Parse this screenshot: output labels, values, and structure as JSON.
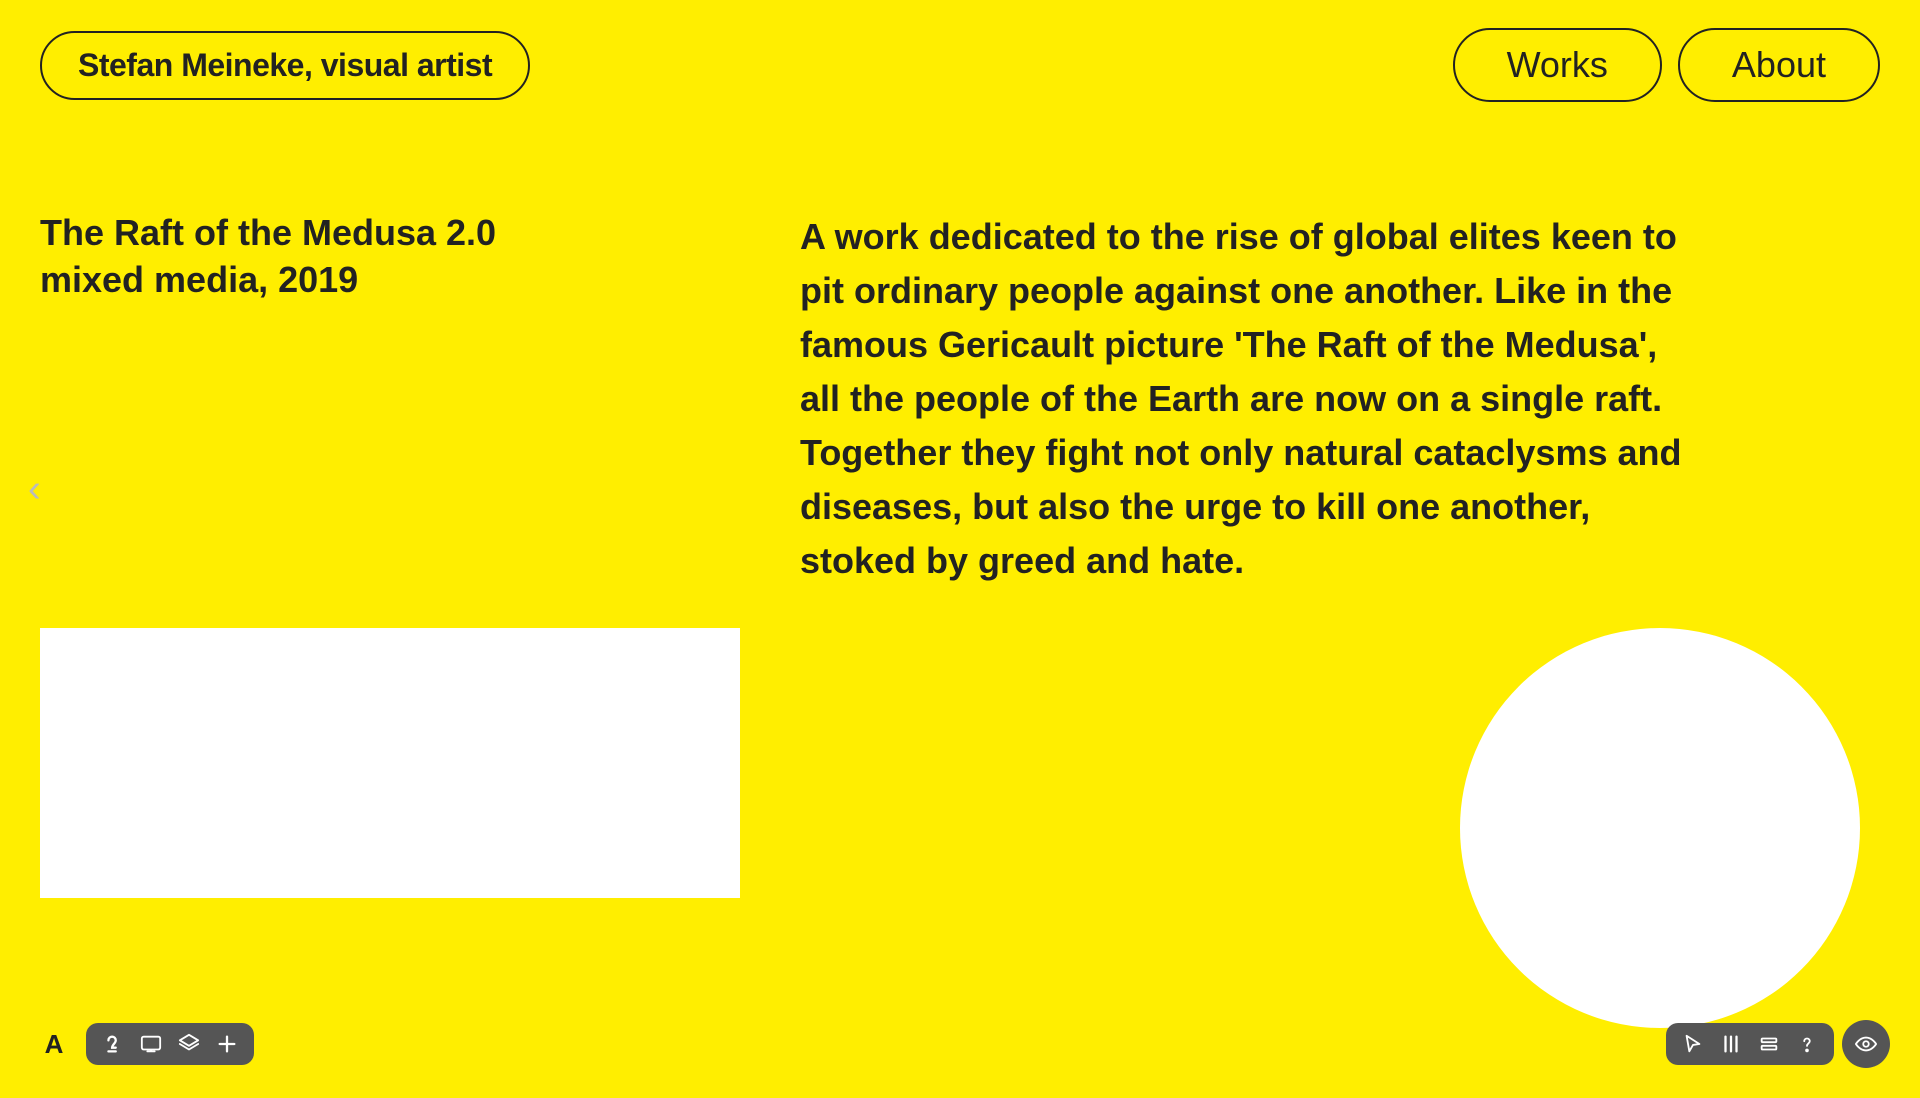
{
  "header": {
    "logo_label": "Stefan Meineke, visual artist",
    "nav": {
      "works_label": "Works",
      "about_label": "About"
    }
  },
  "artwork": {
    "title_line1": "The Raft of the Medusa 2.0",
    "title_line2": "mixed media, 2019",
    "description": "A work dedicated to the rise of global elites keen to pit ordinary people against one another. Like in the famous Gericault picture 'The Raft of the Medusa', all the people of the Earth are now on a single raft. Together they fight not only natural cataclysms and diseases, but also the urge to kill one another, stoked by greed and hate."
  },
  "toolbar_left": {
    "letter": "A",
    "icons": [
      "2",
      "□",
      "◈",
      "+"
    ]
  },
  "toolbar_right": {
    "icons": [
      "cursor",
      "|||",
      "≡",
      "?",
      "eye"
    ]
  },
  "colors": {
    "background": "#FFEE00",
    "text": "#222222",
    "toolbar_bg": "#555555",
    "arrow": "#bbbbbb"
  }
}
